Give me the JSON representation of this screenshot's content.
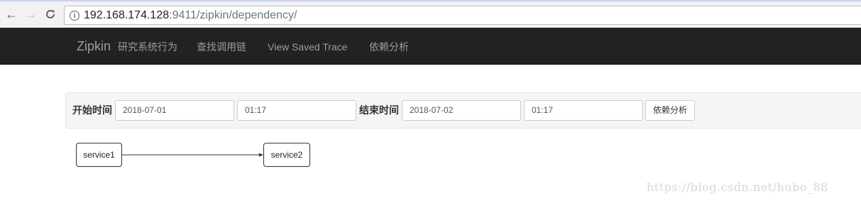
{
  "browser": {
    "url_host": "192.168.174.128",
    "url_rest": ":9411/zipkin/dependency/"
  },
  "navbar": {
    "brand": "Zipkin",
    "links": [
      "研究系统行为",
      "查找调用链",
      "View Saved Trace",
      "依赖分析"
    ]
  },
  "filter": {
    "start_label": "开始时间",
    "start_date": "2018-07-01",
    "start_time": "01:17",
    "end_label": "结束时间",
    "end_date": "2018-07-02",
    "end_time": "01:17",
    "button_label": "依赖分析"
  },
  "graph": {
    "nodes": [
      "service1",
      "service2"
    ],
    "edges": [
      {
        "from": "service1",
        "to": "service2"
      }
    ]
  },
  "watermark": "https://blog.csdn.net/hubo_88"
}
